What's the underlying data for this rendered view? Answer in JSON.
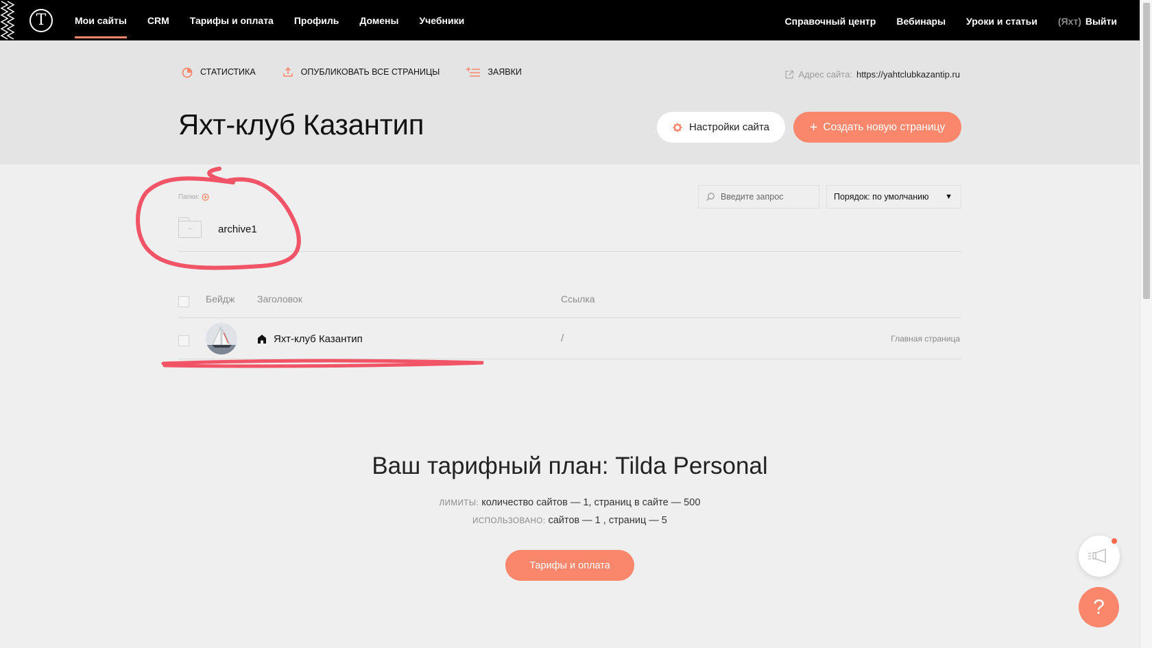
{
  "nav": {
    "left": [
      "Мои сайты",
      "CRM",
      "Тарифы и оплата",
      "Профиль",
      "Домены",
      "Учебники"
    ],
    "right": [
      "Справочный центр",
      "Вебинары",
      "Уроки и статьи"
    ],
    "site_code": "(Яхт)",
    "logout": "Выйти"
  },
  "actions": {
    "stats": "СТАТИСТИКА",
    "publish_all": "ОПУБЛИКОВАТЬ ВСЕ СТРАНИЦЫ",
    "requests": "ЗАЯВКИ"
  },
  "site": {
    "address_label": "Адрес сайта:",
    "address_url": "https://yahtclubkazantip.ru",
    "title": "Яхт-клуб Казантип",
    "settings_button": "Настройки сайта",
    "create_button": "Создать новую страницу"
  },
  "folders": {
    "label": "Папки:",
    "items": [
      {
        "name": "archive1"
      }
    ]
  },
  "search": {
    "placeholder": "Введите запрос"
  },
  "sort": {
    "value": "Порядок: по умолчанию"
  },
  "table": {
    "headers": {
      "badge": "Бейдж",
      "title": "Заголовок",
      "link": "Ссылка"
    },
    "rows": [
      {
        "title": "Яхт-клуб Казантип",
        "link": "/",
        "badge": "Главная страница"
      }
    ]
  },
  "plan": {
    "title": "Ваш тарифный план: Tilda Personal",
    "limits_label": "ЛИМИТЫ:",
    "limits_value": "количество сайтов — 1, страниц в сайте — 500",
    "used_label": "ИСПОЛЬЗОВАНО:",
    "used_value": "сайтов — 1 , страниц — 5",
    "button": "Тарифы и оплата"
  },
  "help": {
    "symbol": "?"
  },
  "icons": {
    "logo": "tilda-logo-icon",
    "stats": "pie-chart-icon",
    "publish": "upload-icon",
    "requests": "list-plus-icon",
    "external": "external-link-icon",
    "settings": "gear-icon",
    "folder": "folder-icon",
    "search": "search-icon",
    "home": "home-icon",
    "news": "megaphone-icon"
  },
  "colors": {
    "accent": "#fa876b",
    "topbar": "#000000",
    "band": "#e4e4e4",
    "background": "#efefef",
    "annotation": "#f0465a"
  }
}
